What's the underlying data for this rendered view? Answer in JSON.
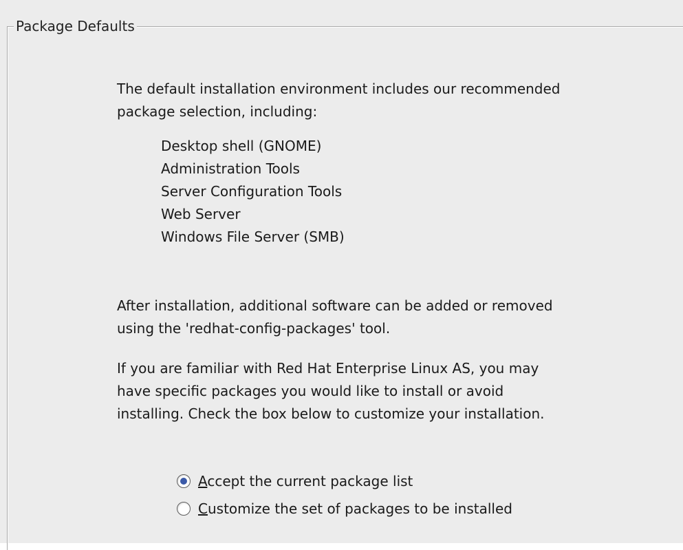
{
  "frame": {
    "title": "Package Defaults"
  },
  "intro": {
    "text": "The default installation environment includes our recommended\npackage selection, including:"
  },
  "packages": [
    "Desktop shell (GNOME)",
    "Administration Tools",
    "Server Configuration Tools",
    "Web Server",
    "Windows File Server (SMB)"
  ],
  "after_install": {
    "text": "After installation, additional software can be added or removed\nusing the 'redhat-config-packages' tool."
  },
  "familiar": {
    "text": "If you are familiar with Red Hat Enterprise Linux AS, you may\nhave specific packages you would like to install or avoid\ninstalling. Check the box below to customize your installation."
  },
  "options": {
    "accept": {
      "mnemonic": "A",
      "rest": "ccept the current package list",
      "selected": true
    },
    "customize": {
      "mnemonic": "C",
      "rest": "ustomize the set of packages to be installed",
      "selected": false
    }
  },
  "colors": {
    "background": "#ececec",
    "frame_border": "#a9a9a9",
    "radio_selected": "#3b5aa8"
  }
}
